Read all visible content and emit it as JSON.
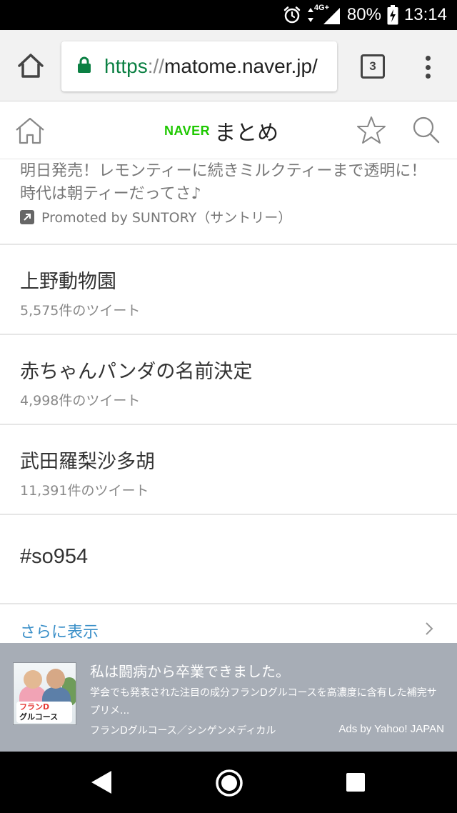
{
  "status_bar": {
    "network": "4G+",
    "battery": "80%",
    "time": "13:14"
  },
  "browser": {
    "url_scheme": "https",
    "url_separator": "://",
    "url_host": "matome.naver.jp/",
    "tab_count": "3"
  },
  "site_header": {
    "logo_brand": "NAVER",
    "logo_name": "まとめ"
  },
  "promo": {
    "text": "明日発売！レモンティーに続きミルクティーまで透明に！時代は朝ティーだってさ♪",
    "sponsor": "Promoted by SUNTORY（サントリー）"
  },
  "trends": [
    {
      "title": "上野動物園",
      "count": "5,575件のツイート"
    },
    {
      "title": "赤ちゃんパンダの名前決定",
      "count": "4,998件のツイート"
    },
    {
      "title": "武田羅梨沙多胡",
      "count": "11,391件のツイート"
    },
    {
      "title": "#so954",
      "count": ""
    }
  ],
  "more": {
    "label": "さらに表示"
  },
  "ad": {
    "image_label_1": "フランD",
    "image_label_2": "グルコース",
    "title": "私は闘病から卒業できました。",
    "description": "学会でも発表された注目の成分フランDグルコースを高濃度に含有した補完サプリメ...",
    "advertiser": "フランDグルコース／シンゲンメディカル",
    "ads_by": "Ads by Yahoo! JAPAN"
  }
}
